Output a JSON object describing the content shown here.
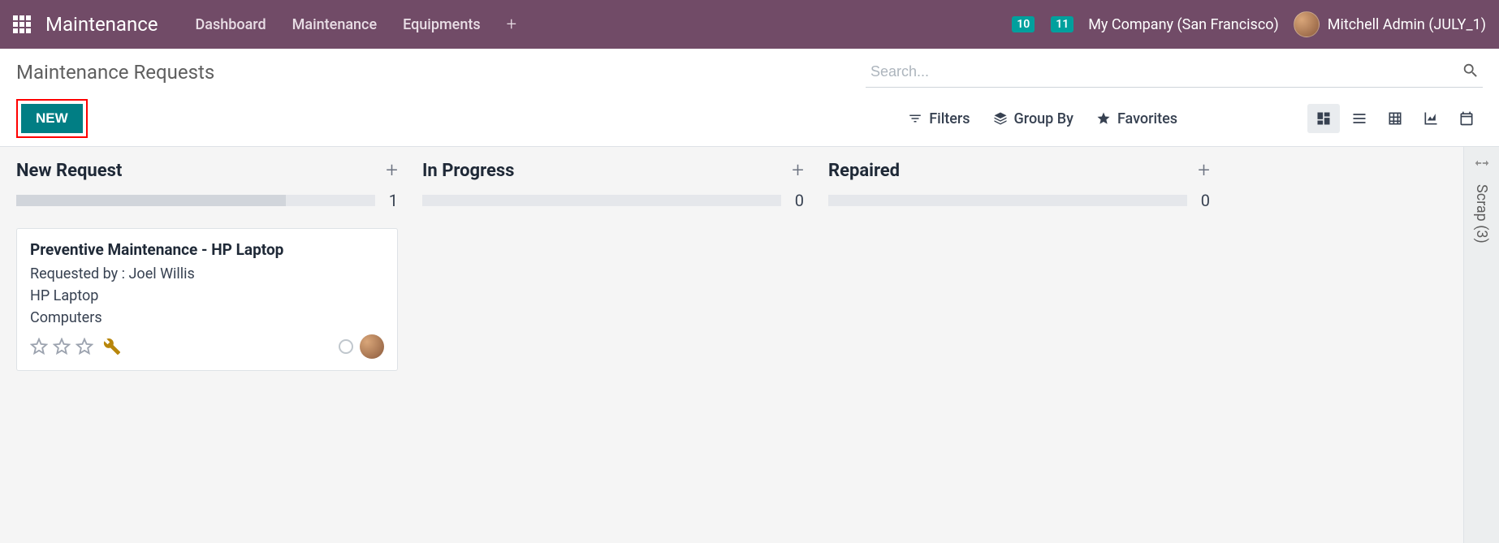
{
  "header": {
    "app_title": "Maintenance",
    "nav": [
      "Dashboard",
      "Maintenance",
      "Equipments"
    ],
    "chat_badge": "10",
    "activity_badge": "11",
    "company": "My Company (San Francisco)",
    "user": "Mitchell Admin (JULY_1)"
  },
  "control": {
    "breadcrumb": "Maintenance Requests",
    "new_button": "NEW",
    "search_placeholder": "Search...",
    "filters_label": "Filters",
    "groupby_label": "Group By",
    "favorites_label": "Favorites"
  },
  "kanban": {
    "columns": [
      {
        "title": "New Request",
        "count": "1"
      },
      {
        "title": "In Progress",
        "count": "0"
      },
      {
        "title": "Repaired",
        "count": "0"
      }
    ],
    "folded": {
      "label": "Scrap (3)"
    },
    "card": {
      "title": "Preventive Maintenance - HP Laptop",
      "requested_by": "Requested by : Joel Willis",
      "equipment": "HP Laptop",
      "category": "Computers"
    }
  }
}
